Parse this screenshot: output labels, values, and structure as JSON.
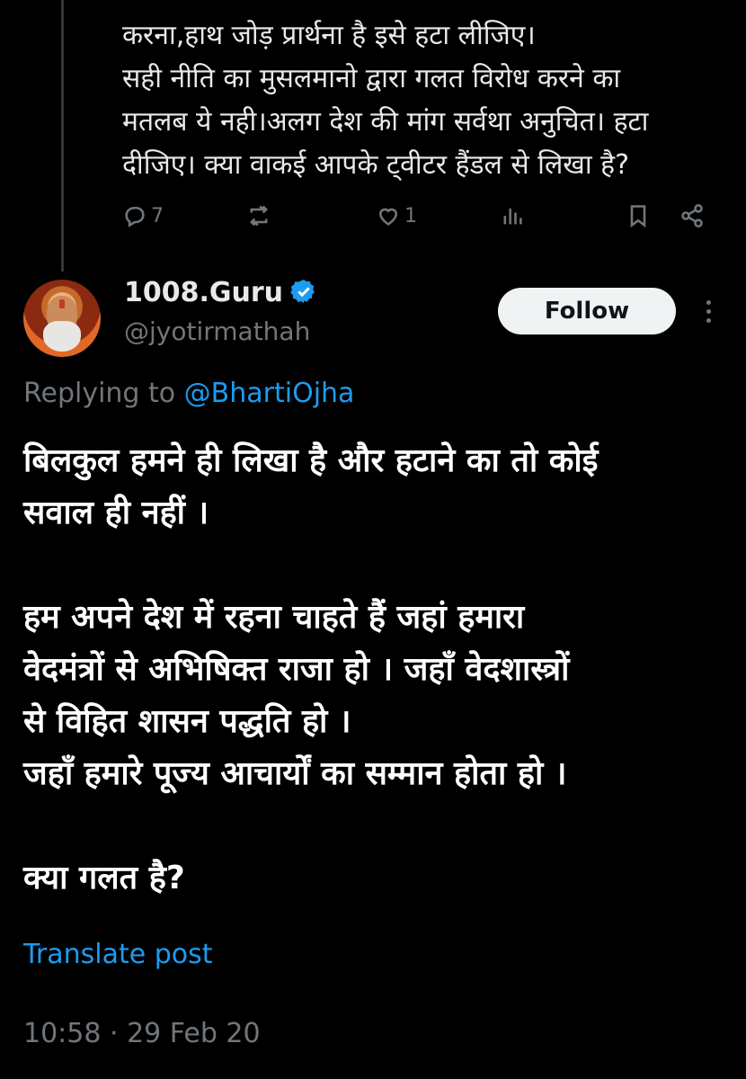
{
  "previous_tweet": {
    "lines": [
      "करना,हाथ जोड़ प्रार्थना है इसे हटा लीजिए।",
      "सही नीति का मुसलमानो द्वारा गलत विरोध करने का",
      "मतलब ये नही।अलग देश की मांग सर्वथा अनुचित। हटा",
      "दीजिए। क्या वाकई आपके ट्वीटर हैंडल से लिखा है?"
    ],
    "actions": {
      "reply_count": "7",
      "repost_count": "",
      "like_count": "1"
    }
  },
  "author": {
    "display_name": "1008.Guru",
    "handle": "@jyotirmathah",
    "verified_color": "#1d9bf0"
  },
  "follow_label": "Follow",
  "replying": {
    "prefix": "Replying to ",
    "mention": "@BhartiOjha"
  },
  "tweet": {
    "line_1": "बिलकुल हमने ही लिखा है और हटाने का तो कोई",
    "line_2": "सवाल ही नहीं ।",
    "line_3": "हम अपने देश में रहना चाहते हैं जहां हमारा",
    "line_4": "वेदमंत्रों से अभिषिक्त राजा हो । जहाँ वेदशास्त्रों",
    "line_5": "से विहित शासन पद्धति हो ।",
    "line_6": "जहाँ हमारे पूज्य आचार्यों का सम्मान होता हो ।",
    "line_7": "क्या गलत है?"
  },
  "translate_label": "Translate post",
  "timestamp": "10:58 · 29 Feb 20",
  "colors": {
    "background": "#000000",
    "text": "#e7e9ea",
    "muted": "#71767b",
    "link": "#1d9bf0"
  }
}
